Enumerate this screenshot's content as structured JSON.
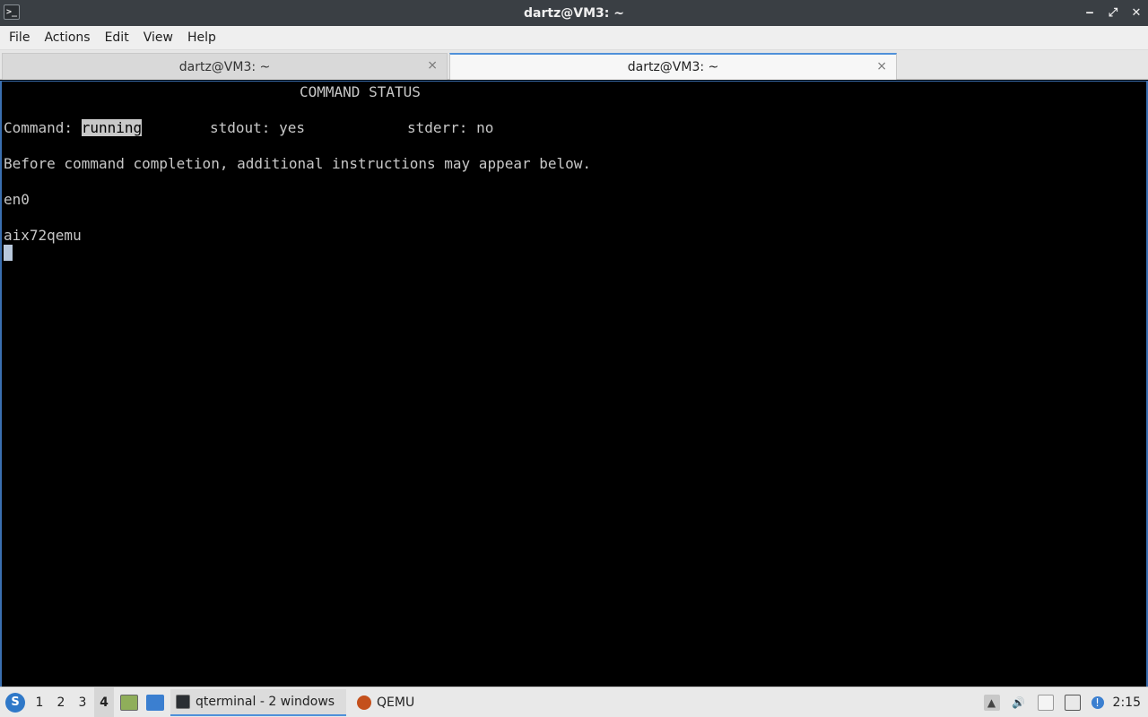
{
  "window": {
    "title": "dartz@VM3: ~",
    "minimize": "‒",
    "restore": "⤢",
    "close": "✕"
  },
  "menu": [
    "File",
    "Actions",
    "Edit",
    "View",
    "Help"
  ],
  "tabs": [
    {
      "label": "dartz@VM3: ~",
      "close": "⨯",
      "active": false
    },
    {
      "label": "dartz@VM3: ~",
      "close": "⨯",
      "active": true
    }
  ],
  "terminal": {
    "heading": "COMMAND STATUS",
    "command_label": "Command:",
    "command_status": "running",
    "stdout": "stdout: yes",
    "stderr": "stderr: no",
    "note": "Before command completion, additional instructions may appear below.",
    "line1": "en0",
    "line2": "aix72qemu"
  },
  "taskbar": {
    "start_glyph": "S",
    "workspaces": [
      "1",
      "2",
      "3",
      "4"
    ],
    "active_workspace": "4",
    "tasks": [
      {
        "label": "qterminal - 2 windows",
        "icon": "terminal-icon",
        "active": true
      },
      {
        "label": "QEMU",
        "icon": "qemu-icon",
        "active": false
      }
    ],
    "clock": "2:15",
    "notification_glyph": "!"
  },
  "colors": {
    "accent": "#4f90d9",
    "terminal_bg": "#000000",
    "terminal_fg": "#c8c8c8"
  }
}
